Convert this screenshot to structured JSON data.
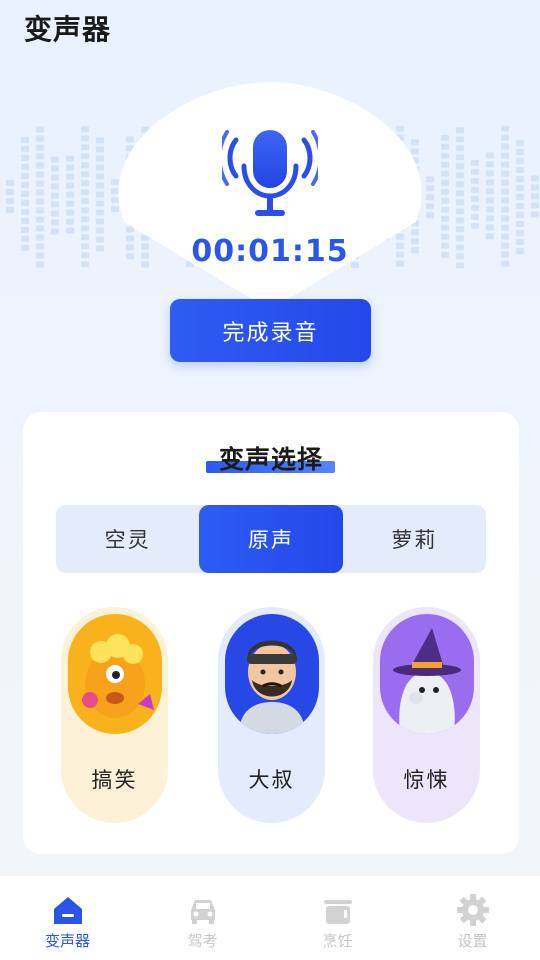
{
  "app": {
    "title": "变声器"
  },
  "recorder": {
    "timer": "00:01:15",
    "finish_label": "完成录音"
  },
  "voice_select": {
    "title": "变声选择",
    "tabs": [
      {
        "label": "空灵",
        "active": false
      },
      {
        "label": "原声",
        "active": true
      },
      {
        "label": "萝莉",
        "active": false
      }
    ],
    "voices": [
      {
        "label": "搞笑",
        "icon": "funny-monster-icon",
        "bg": "#fdf2d8",
        "avatar_bg": "#f9b21c"
      },
      {
        "label": "大叔",
        "icon": "uncle-avatar-icon",
        "bg": "#e3ebfc",
        "avatar_bg": "#2747e6"
      },
      {
        "label": "惊悚",
        "icon": "ghost-witch-icon",
        "bg": "#ede6fb",
        "avatar_bg": "#9a6cef"
      }
    ]
  },
  "nav": {
    "items": [
      {
        "label": "变声器",
        "icon": "home-icon",
        "active": true
      },
      {
        "label": "驾考",
        "icon": "car-icon",
        "active": false
      },
      {
        "label": "烹饪",
        "icon": "pot-icon",
        "active": false
      },
      {
        "label": "设置",
        "icon": "gear-icon",
        "active": false
      }
    ]
  },
  "colors": {
    "accent": "#2b55ea",
    "timer": "#2a57e6"
  }
}
